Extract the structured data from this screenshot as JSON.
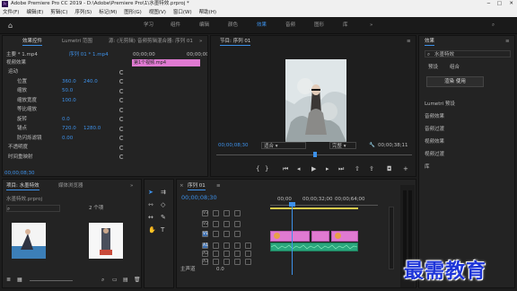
{
  "window": {
    "title": "Adobe Premiere Pro CC 2019 - D:\\Adobe\\Premiere Pro\\1\\水墨特效.prproj *"
  },
  "menu": [
    "文件(F)",
    "编辑(E)",
    "剪辑(C)",
    "序列(S)",
    "标记(M)",
    "图形(G)",
    "视图(V)",
    "窗口(W)",
    "帮助(H)"
  ],
  "workspaces": [
    "学习",
    "组件",
    "编辑",
    "颜色",
    "效果",
    "音频",
    "图形",
    "库"
  ],
  "active_workspace": "效果",
  "effect_controls": {
    "tabs": [
      "效果控件",
      "Lumetri 范围",
      "源: (无剪辑)",
      "音频剪辑混合器: 序列 01"
    ],
    "source": "主要 * 1.mp4",
    "sequence": "序列 01 * 1.mp4",
    "timecode": "00;00;00",
    "video_section": "视频效果",
    "rows": [
      {
        "label": "运动",
        "fx": true
      },
      {
        "label": "位置",
        "v1": "360.0",
        "v2": "240.0"
      },
      {
        "label": "缩放",
        "v1": "50.0",
        "v2": ""
      },
      {
        "label": "缩放宽度",
        "v1": "100.0",
        "v2": ""
      },
      {
        "label": "等比缩放",
        "v1": "",
        "v2": ""
      },
      {
        "label": "旋转",
        "v1": "0.0",
        "v2": ""
      },
      {
        "label": "锚点",
        "v1": "720.0",
        "v2": "1280.0"
      },
      {
        "label": "防闪烁滤镜",
        "v1": "0.00",
        "v2": ""
      },
      {
        "label": "不透明度",
        "fx": true
      },
      {
        "label": "时间重映射",
        "fx": true
      }
    ],
    "clip_label": "第1个视频.mp4",
    "footer_time": "00;00;08;30"
  },
  "program": {
    "title": "节目: 序列 01",
    "timecode": "00;00;08;30",
    "zoom": "适合",
    "quality": "完整",
    "duration": "00;00;38;11"
  },
  "effects_panel": {
    "title": "效果",
    "search_placeholder": "水墨特效",
    "tabs": [
      "预设",
      "组合"
    ],
    "button": "渲染 使用",
    "sections": [
      "Lumetri 预设",
      "音频效果",
      "音频过渡",
      "视频效果",
      "视频过渡",
      "库"
    ]
  },
  "project": {
    "tabs": [
      "项目: 水墨特效",
      "媒体浏览器"
    ],
    "file": "水墨特效.prproj",
    "count": "2 个项"
  },
  "timeline": {
    "title": "序列 01",
    "timecode": "00;00;08;30",
    "ruler": [
      "00;00",
      "00;00;32;00",
      "00;00;64;00"
    ],
    "tracks_video": [
      "V3",
      "V2",
      "V1"
    ],
    "tracks_audio": [
      "A1",
      "A2",
      "A3"
    ],
    "master": "主声道",
    "master_value": "0.0"
  },
  "watermark": "最需教育",
  "colors": {
    "accent": "#3d91ea",
    "clip": "#e07ad2",
    "audio": "#2aa77d",
    "watermark": "#1e35d8"
  }
}
